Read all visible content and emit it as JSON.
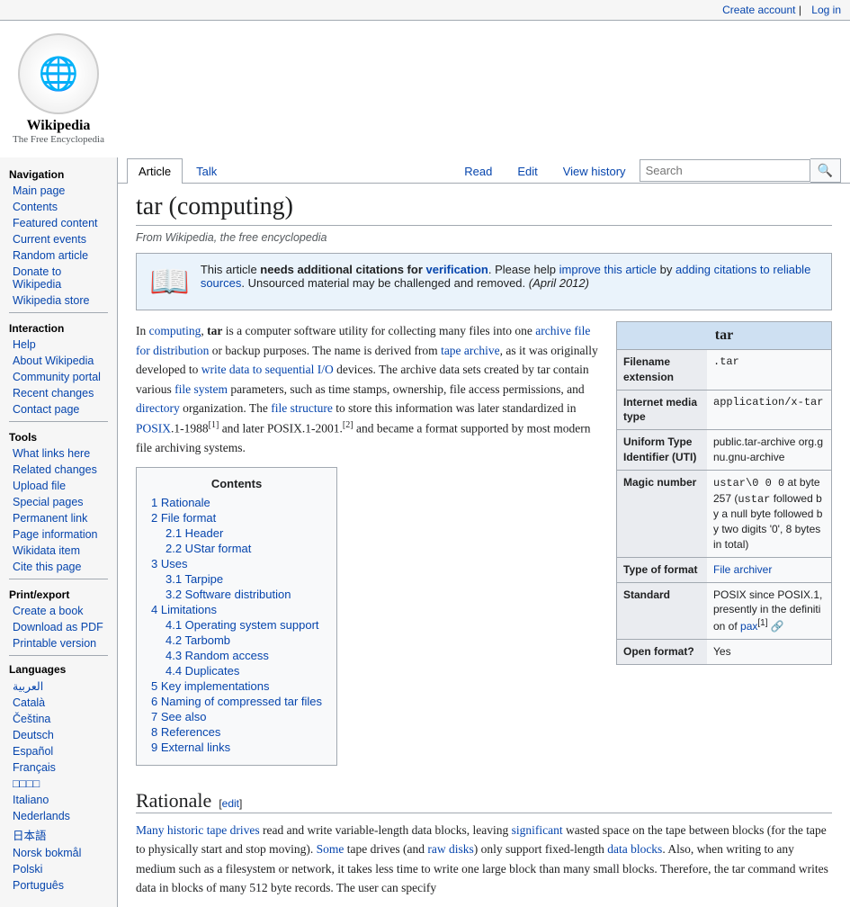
{
  "topbar": {
    "create_account": "Create account",
    "log_in": "Log in"
  },
  "logo": {
    "puzzle_char": "🌐",
    "site_name": "Wikipedia",
    "tagline": "The Free Encyclopedia"
  },
  "sidebar": {
    "navigation_title": "Navigation",
    "nav_items": [
      {
        "label": "Main page",
        "id": "main-page"
      },
      {
        "label": "Contents",
        "id": "contents"
      },
      {
        "label": "Featured content",
        "id": "featured-content"
      },
      {
        "label": "Current events",
        "id": "current-events"
      },
      {
        "label": "Random article",
        "id": "random-article"
      },
      {
        "label": "Donate to Wikipedia",
        "id": "donate"
      },
      {
        "label": "Wikipedia store",
        "id": "wikipedia-store"
      }
    ],
    "interaction_title": "Interaction",
    "interaction_items": [
      {
        "label": "Help",
        "id": "help"
      },
      {
        "label": "About Wikipedia",
        "id": "about"
      },
      {
        "label": "Community portal",
        "id": "community-portal"
      },
      {
        "label": "Recent changes",
        "id": "recent-changes"
      },
      {
        "label": "Contact page",
        "id": "contact"
      }
    ],
    "tools_title": "Tools",
    "tools_items": [
      {
        "label": "What links here",
        "id": "what-links-here"
      },
      {
        "label": "Related changes",
        "id": "related-changes"
      },
      {
        "label": "Upload file",
        "id": "upload-file"
      },
      {
        "label": "Special pages",
        "id": "special-pages"
      },
      {
        "label": "Permanent link",
        "id": "permanent-link"
      },
      {
        "label": "Page information",
        "id": "page-information"
      },
      {
        "label": "Wikidata item",
        "id": "wikidata-item"
      },
      {
        "label": "Cite this page",
        "id": "cite-this-page"
      }
    ],
    "print_title": "Print/export",
    "print_items": [
      {
        "label": "Create a book",
        "id": "create-book"
      },
      {
        "label": "Download as PDF",
        "id": "download-pdf"
      },
      {
        "label": "Printable version",
        "id": "printable-version"
      }
    ],
    "languages_title": "Languages",
    "language_items": [
      {
        "label": "العربية",
        "id": "lang-ar"
      },
      {
        "label": "Català",
        "id": "lang-ca"
      },
      {
        "label": "Čeština",
        "id": "lang-cs"
      },
      {
        "label": "Deutsch",
        "id": "lang-de"
      },
      {
        "label": "Español",
        "id": "lang-es"
      },
      {
        "label": "Français",
        "id": "lang-fr"
      },
      {
        "label": "□□□□",
        "id": "lang-jp1"
      },
      {
        "label": "Italiano",
        "id": "lang-it"
      },
      {
        "label": "Nederlands",
        "id": "lang-nl"
      },
      {
        "label": "日本語",
        "id": "lang-ja"
      },
      {
        "label": "Norsk bokmål",
        "id": "lang-nb"
      },
      {
        "label": "Polski",
        "id": "lang-pl"
      },
      {
        "label": "Português",
        "id": "lang-pt"
      }
    ]
  },
  "tabs": [
    {
      "label": "Article",
      "id": "tab-article",
      "active": true
    },
    {
      "label": "Talk",
      "id": "tab-talk",
      "active": false
    }
  ],
  "tab_actions": [
    {
      "label": "Read",
      "id": "tab-read"
    },
    {
      "label": "Edit",
      "id": "tab-edit"
    },
    {
      "label": "View history",
      "id": "tab-view-history"
    }
  ],
  "search": {
    "placeholder": "Search",
    "button_icon": "🔍"
  },
  "page": {
    "title": "tar (computing)",
    "from_text": "From Wikipedia, the free encyclopedia"
  },
  "notice": {
    "icon": "📖",
    "text_parts": [
      "This article ",
      "needs additional citations for",
      " verification",
      ". Please help ",
      "improve this article",
      " by ",
      "adding citations to reliable sources",
      ". Unsourced material may be challenged and removed. ",
      "(April 2012)"
    ],
    "needs_citations_label": "needs additional citations for",
    "verification_link": "verification",
    "improve_link": "improve this article",
    "adding_link": "adding citations to reliable sources",
    "date": "(April 2012)"
  },
  "article": {
    "intro": "In computing, tar is a computer software utility for collecting many files into one archive file for distribution or backup purposes. The name is derived from tape archive, as it was originally developed to write data to sequential I/O devices. The archive data sets created by tar contain various file system parameters, such as time stamps, ownership, file access permissions, and directory organization. The file structure to store this information was later standardized in POSIX.1-1988",
    "ref1": "[1]",
    "intro2": " and later POSIX.1-2001.",
    "ref2": "[2]",
    "intro3": " and became a format supported by most modern file archiving systems."
  },
  "infobox": {
    "title": "tar",
    "rows": [
      {
        "label": "Filename extension",
        "value": ".tar",
        "mono": true
      },
      {
        "label": "Internet media type",
        "value": "application/x-tar",
        "mono": true
      },
      {
        "label": "Uniform Type Identifier (UTI)",
        "value": "public.tar-archive org.gnu.gnu-archive",
        "mono": false
      },
      {
        "label": "Magic number",
        "value": "ustar\\0 0 0 at byte 257 (ustar followed by a null byte followed by two digits '0', 8 bytes in total)",
        "mono": false
      },
      {
        "label": "Type of format",
        "value": "File archiver",
        "link": true
      },
      {
        "label": "Standard",
        "value": "POSIX since POSIX.1, presently in the definition of pax[1]",
        "link": true
      },
      {
        "label": "Open format?",
        "value": "Yes",
        "mono": false
      }
    ]
  },
  "toc": {
    "title": "Contents",
    "items": [
      {
        "num": "1",
        "label": "Rationale",
        "id": "toc-1"
      },
      {
        "num": "2",
        "label": "File format",
        "id": "toc-2",
        "sub": [
          {
            "num": "2.1",
            "label": "Header",
            "id": "toc-2-1"
          },
          {
            "num": "2.2",
            "label": "UStar format",
            "id": "toc-2-2"
          }
        ]
      },
      {
        "num": "3",
        "label": "Uses",
        "id": "toc-3",
        "sub": [
          {
            "num": "3.1",
            "label": "Tarpipe",
            "id": "toc-3-1"
          },
          {
            "num": "3.2",
            "label": "Software distribution",
            "id": "toc-3-2"
          }
        ]
      },
      {
        "num": "4",
        "label": "Limitations",
        "id": "toc-4",
        "sub": [
          {
            "num": "4.1",
            "label": "Operating system support",
            "id": "toc-4-1"
          },
          {
            "num": "4.2",
            "label": "Tarbomb",
            "id": "toc-4-2"
          },
          {
            "num": "4.3",
            "label": "Random access",
            "id": "toc-4-3"
          },
          {
            "num": "4.4",
            "label": "Duplicates",
            "id": "toc-4-4"
          }
        ]
      },
      {
        "num": "5",
        "label": "Key implementations",
        "id": "toc-5"
      },
      {
        "num": "6",
        "label": "Naming of compressed tar files",
        "id": "toc-6"
      },
      {
        "num": "7",
        "label": "See also",
        "id": "toc-7"
      },
      {
        "num": "8",
        "label": "References",
        "id": "toc-8"
      },
      {
        "num": "9",
        "label": "External links",
        "id": "toc-9"
      }
    ]
  },
  "sections": {
    "rationale": {
      "title": "Rationale",
      "edit_label": "[edit]",
      "text": "Many historic tape drives read and write variable-length data blocks, leaving significant wasted space on the tape between blocks (for the tape to physically start and stop moving). Some tape drives (and raw disks) only support fixed-length data blocks. Also, when writing to any medium such as a filesystem or network, it takes less time to write one large block than many small blocks. Therefore, the tar command writes data in blocks of many 512 byte records. The user can specify"
    }
  }
}
